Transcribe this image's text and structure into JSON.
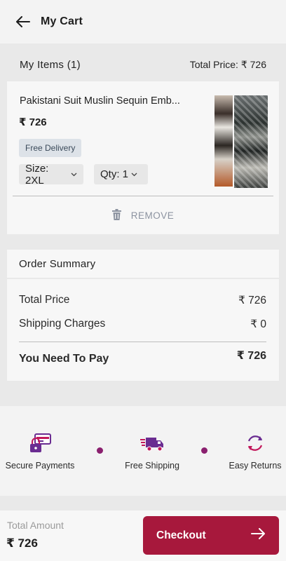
{
  "appbar": {
    "title": "My Cart",
    "back_icon": "arrow-left-icon"
  },
  "items": {
    "header": "My Items (1)",
    "total_label": "Total Price: ₹ 726",
    "list": [
      {
        "name": "Pakistani Suit Muslin Sequin Emb...",
        "price": "₹ 726",
        "badge": "Free Delivery",
        "size": "Size: 2XL",
        "qty": "Qty: 1",
        "remove_label": "REMOVE"
      }
    ]
  },
  "summary": {
    "title": "Order Summary",
    "rows": [
      {
        "label": "Total Price",
        "value": "₹ 726"
      },
      {
        "label": "Shipping Charges",
        "value": "₹ 0"
      }
    ],
    "pay": {
      "label": "You Need To Pay",
      "value": "₹ 726"
    }
  },
  "features": [
    {
      "label": "Secure Payments",
      "icon": "secure-payment-icon"
    },
    {
      "label": "Free Shipping",
      "icon": "truck-icon"
    },
    {
      "label": "Easy Returns",
      "icon": "returns-icon"
    }
  ],
  "footer": {
    "total_label": "Total Amount",
    "total_value": "₹ 726",
    "checkout_label": "Checkout"
  },
  "colors": {
    "accent": "#a7183c",
    "feature_purple": "#6a2c91",
    "dot": "#8a1f6e"
  }
}
